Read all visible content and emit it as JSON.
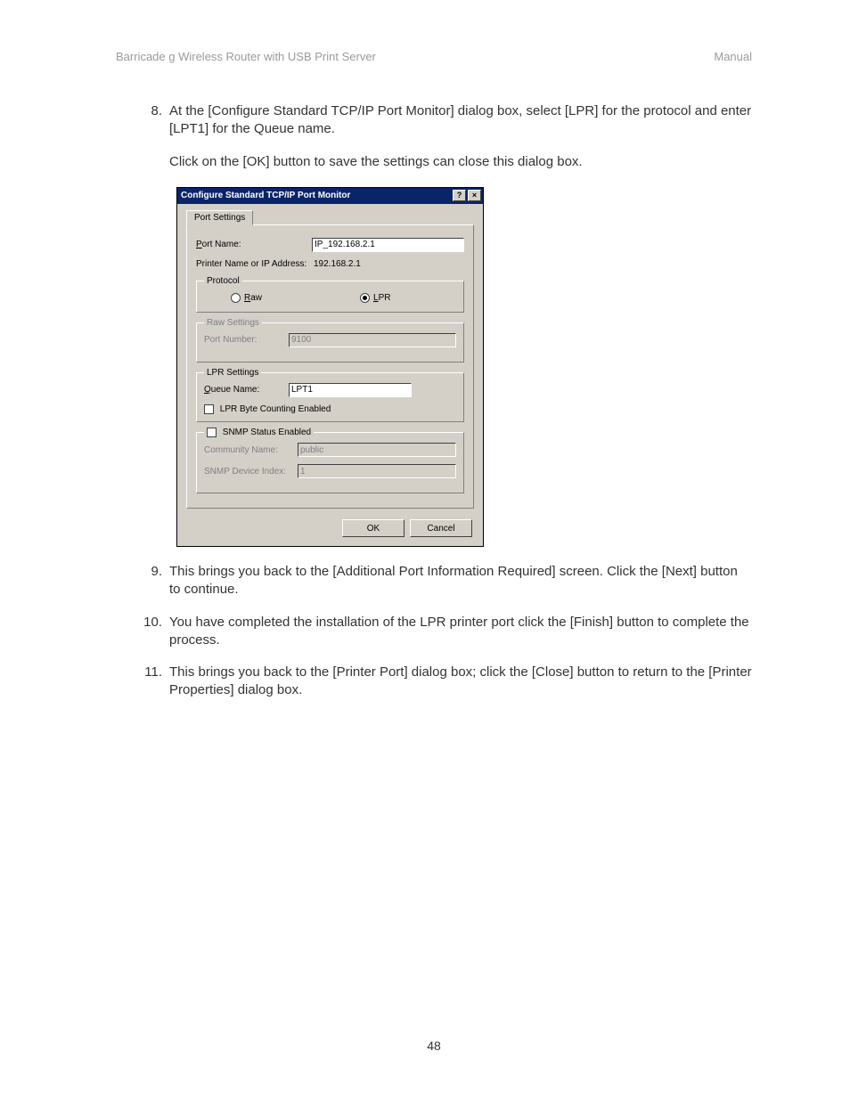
{
  "header": {
    "left": "Barricade g Wireless Router with USB Print Server",
    "right": "Manual"
  },
  "steps": {
    "s8": {
      "num": "8.",
      "p1": "At the [Configure Standard TCP/IP Port Monitor] dialog box, select [LPR] for the protocol and enter [LPT1] for the Queue name.",
      "p2": "Click on the [OK] button to save the settings can close this dialog box."
    },
    "s9": {
      "num": "9.",
      "p1": "This brings you back to the [Additional Port Information Required] screen.  Click the [Next] button to continue."
    },
    "s10": {
      "num": "10.",
      "p1": "You have completed the installation of the LPR printer port click the [Finish] button to complete the process."
    },
    "s11": {
      "num": "11.",
      "p1": "This brings you back to the [Printer Port] dialog box; click the [Close] button to return to the [Printer Properties] dialog box."
    }
  },
  "dialog": {
    "title": "Configure Standard TCP/IP Port Monitor",
    "help_glyph": "?",
    "close_glyph": "×",
    "tab": "Port Settings",
    "port_name_label": "Port Name:",
    "port_name_value": "IP_192.168.2.1",
    "printer_addr_label": "Printer Name or IP Address:",
    "printer_addr_value": "192.168.2.1",
    "protocol": {
      "legend": "Protocol",
      "raw": "Raw",
      "lpr": "LPR"
    },
    "raw_settings": {
      "legend": "Raw Settings",
      "port_number_label": "Port Number:",
      "port_number_value": "9100"
    },
    "lpr_settings": {
      "legend": "LPR Settings",
      "queue_label": "Queue Name:",
      "queue_value": "LPT1",
      "byte_counting": "LPR Byte Counting Enabled"
    },
    "snmp": {
      "legend": "SNMP Status Enabled",
      "community_label": "Community Name:",
      "community_value": "public",
      "device_index_label": "SNMP Device Index:",
      "device_index_value": "1"
    },
    "buttons": {
      "ok": "OK",
      "cancel": "Cancel"
    }
  },
  "page_number": "48"
}
